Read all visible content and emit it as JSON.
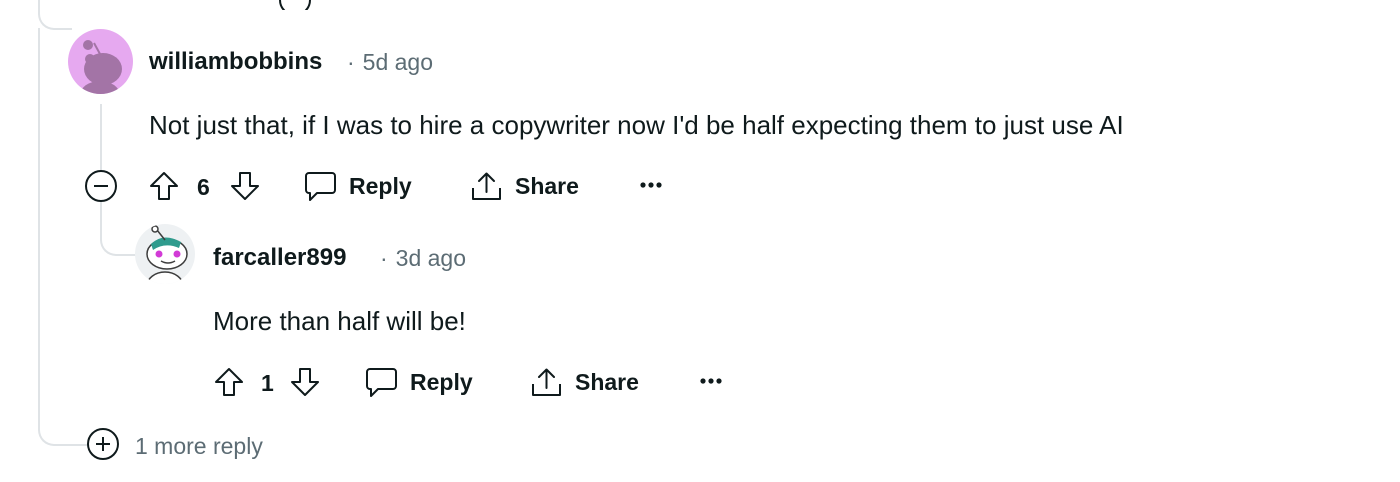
{
  "comments": [
    {
      "username": "williambobbins",
      "separator": "·",
      "time": "5d ago",
      "body": "Not just that, if I was to hire a copywriter now I'd be half expecting them to just use AI",
      "votes": "6",
      "reply_label": "Reply",
      "share_label": "Share",
      "avatar_color": "#e6a9f0"
    },
    {
      "username": "farcaller899",
      "separator": "·",
      "time": "3d ago",
      "body": "More than half will be!",
      "votes": "1",
      "reply_label": "Reply",
      "share_label": "Share",
      "avatar_color": "#eef1f3"
    }
  ],
  "more_replies_label": "1 more reply",
  "icons": {
    "collapse": "collapse-minus-icon",
    "expand": "expand-plus-icon",
    "upvote": "upvote-arrow-icon",
    "downvote": "downvote-arrow-icon",
    "reply": "comment-bubble-icon",
    "share": "share-icon",
    "more": "more-options-icon"
  },
  "colors": {
    "text": "#0f1a1c",
    "meta": "#5c6c74",
    "thread_line": "#dfe3e6"
  }
}
